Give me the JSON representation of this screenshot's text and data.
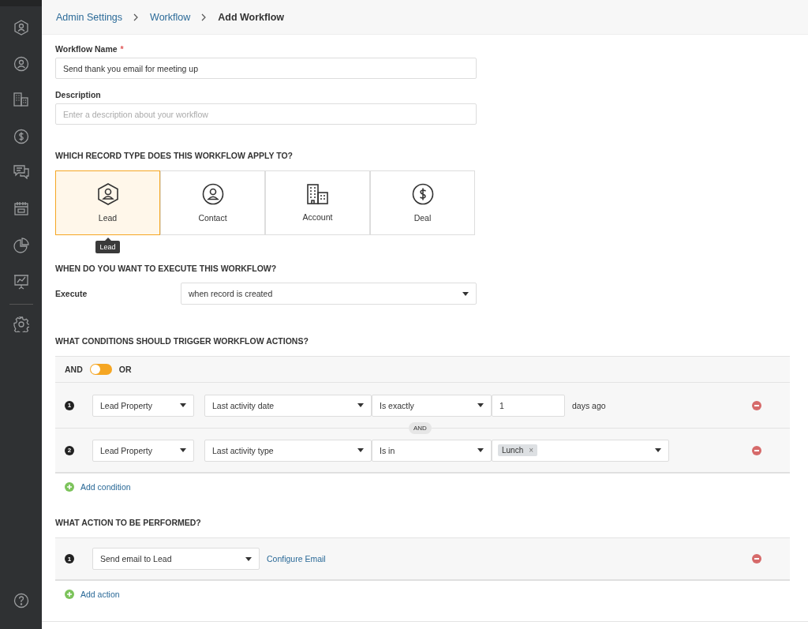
{
  "sidebar": {
    "items": [
      {
        "kind": "lead"
      },
      {
        "kind": "contact"
      },
      {
        "kind": "account"
      },
      {
        "kind": "deal"
      },
      {
        "kind": "chat"
      },
      {
        "kind": "calendar"
      },
      {
        "kind": "pie"
      },
      {
        "kind": "presentation"
      },
      {
        "kind": "divider"
      },
      {
        "kind": "settings"
      }
    ],
    "bottom": {
      "kind": "help"
    }
  },
  "breadcrumb": [
    {
      "label": "Admin Settings",
      "current": false
    },
    {
      "label": "Workflow",
      "current": false
    },
    {
      "label": "Add Workflow",
      "current": true
    }
  ],
  "name_field": {
    "label": "Workflow Name",
    "required": true,
    "required_mark": "*",
    "value": "Send thank you email for meeting up"
  },
  "description_field": {
    "label": "Description",
    "placeholder": "Enter a description about your workflow"
  },
  "record_section": {
    "heading": "WHICH RECORD TYPE DOES THIS WORKFLOW APPLY TO?",
    "types": [
      {
        "kind": "lead",
        "label": "Lead",
        "selected": true
      },
      {
        "kind": "contact",
        "label": "Contact",
        "selected": false
      },
      {
        "kind": "account",
        "label": "Account",
        "selected": false
      },
      {
        "kind": "deal",
        "label": "Deal",
        "selected": false
      }
    ],
    "tooltip": "Lead"
  },
  "execute_section": {
    "heading": "WHEN DO YOU WANT TO EXECUTE THIS WORKFLOW?",
    "label": "Execute",
    "value": "when record is created"
  },
  "conditions_section": {
    "heading": "WHAT CONDITIONS SHOULD TRIGGER WORKFLOW ACTIONS?",
    "and_label": "AND",
    "or_label": "OR",
    "toggle_on": false,
    "conditions": [
      {
        "number": "1",
        "entity": "Lead Property",
        "field": "Last activity date",
        "operator": "Is exactly",
        "kind": "input",
        "value": "1",
        "suffix": "days ago"
      },
      {
        "number": "2",
        "entity": "Lead Property",
        "field": "Last activity type",
        "operator": "Is in",
        "kind": "tags",
        "tags": [
          "Lunch"
        ],
        "tag_remove": "×"
      }
    ],
    "connector": "AND",
    "add_label": "Add condition"
  },
  "actions_section": {
    "heading": "WHAT ACTION TO BE PERFORMED?",
    "actions": [
      {
        "number": "1",
        "action": "Send email to Lead",
        "link": "Configure Email"
      }
    ],
    "add_label": "Add action"
  }
}
